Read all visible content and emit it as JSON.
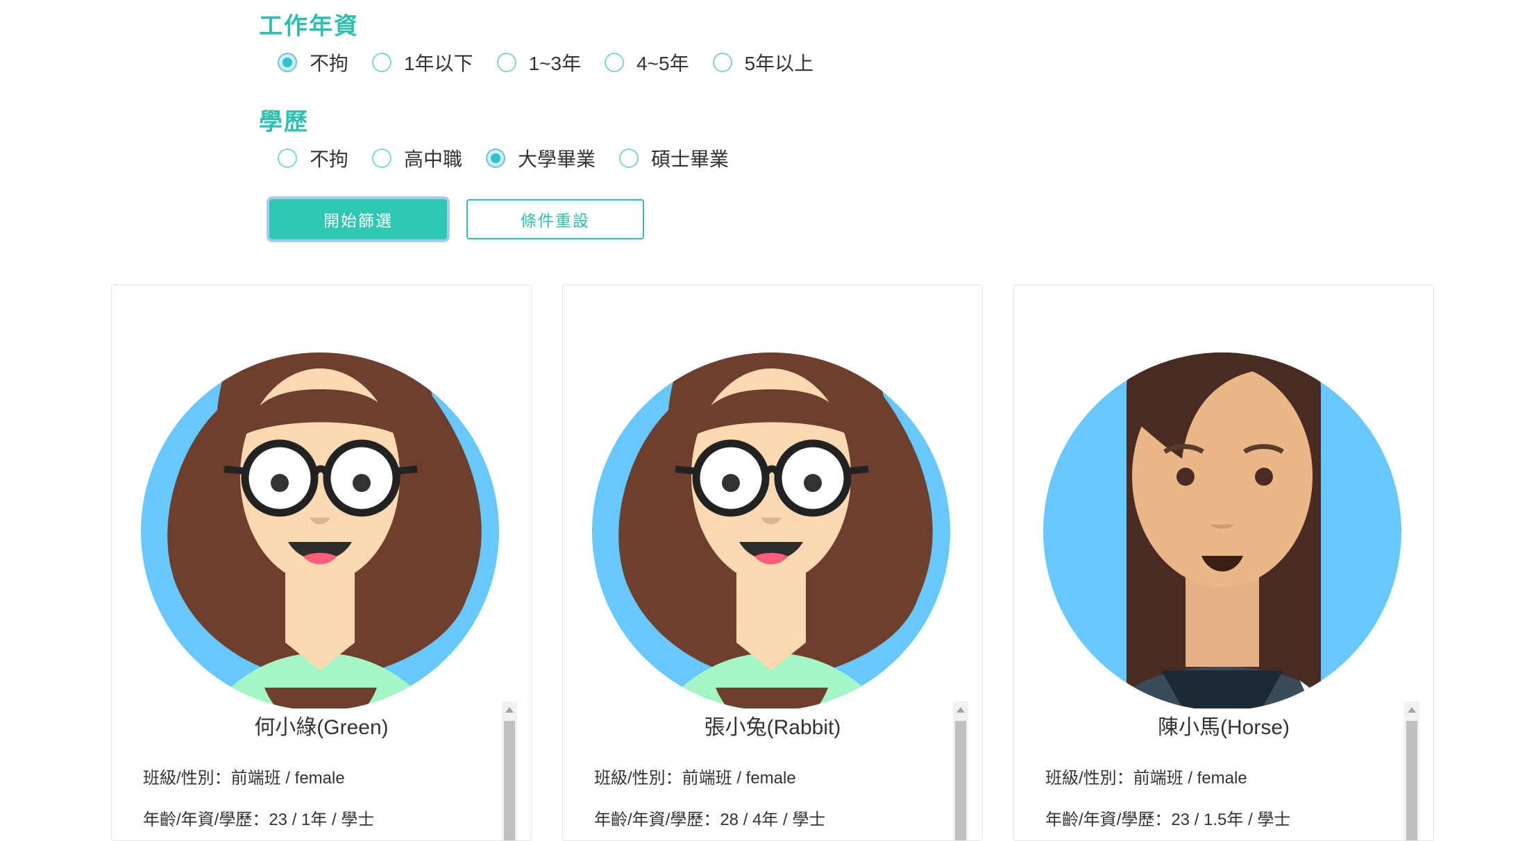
{
  "filters": {
    "experience": {
      "title": "工作年資",
      "options": [
        "不拘",
        "1年以下",
        "1~3年",
        "4~5年",
        "5年以上"
      ],
      "selected": "不拘"
    },
    "education": {
      "title": "學歷",
      "options": [
        "不拘",
        "高中職",
        "大學畢業",
        "碩士畢業"
      ],
      "selected": "大學畢業"
    },
    "buttons": {
      "apply": "開始篩選",
      "reset": "條件重設"
    }
  },
  "cards": [
    {
      "name": "何小綠(Green)",
      "class_gender": "班級/性別：前端班 / female",
      "age_exp_edu": "年齡/年資/學歷：23 / 1年 / 學士",
      "avatar": "woman-glasses-curly-hair-avatar"
    },
    {
      "name": "張小兔(Rabbit)",
      "class_gender": "班級/性別：前端班 / female",
      "age_exp_edu": "年齡/年資/學歷：28 / 4年 / 學士",
      "avatar": "woman-glasses-curly-hair-avatar"
    },
    {
      "name": "陳小馬(Horse)",
      "class_gender": "班級/性別：前端班 / female",
      "age_exp_edu": "年齡/年資/學歷：23 / 1.5年 / 學士",
      "avatar": "woman-long-hair-avatar"
    }
  ],
  "colors": {
    "accent": "#2cc0ae",
    "avatar_bg": "#67c8fb",
    "focus_ring": "#a9c8f3"
  }
}
